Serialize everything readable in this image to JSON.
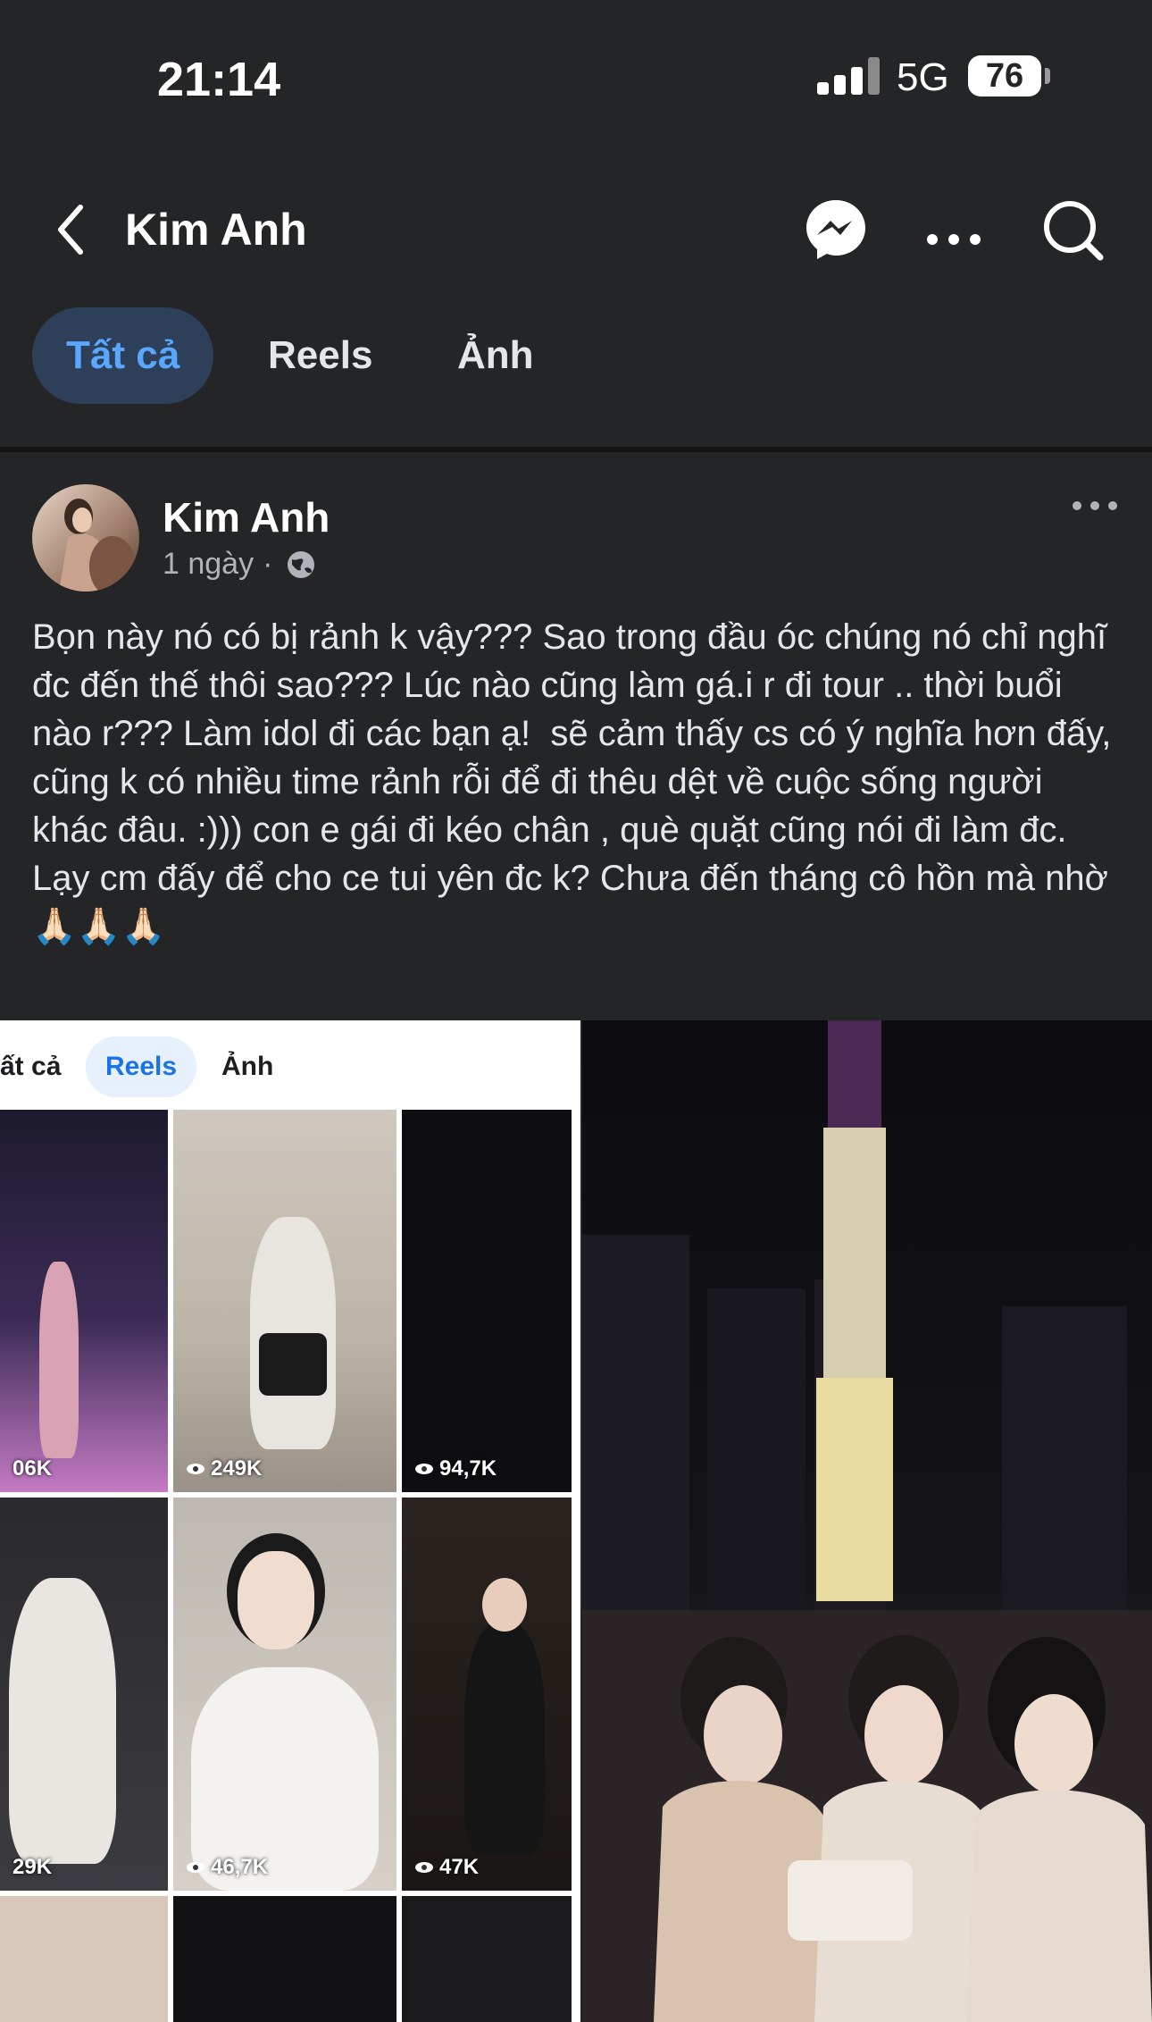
{
  "status_bar": {
    "time": "21:14",
    "network": "5G",
    "battery": "76"
  },
  "header": {
    "title": "Kim Anh"
  },
  "tabs": [
    {
      "label": "Tất cả",
      "active": true
    },
    {
      "label": "Reels",
      "active": false
    },
    {
      "label": "Ảnh",
      "active": false
    }
  ],
  "post": {
    "author": "Kim Anh",
    "time": "1 ngày",
    "separator": "·",
    "text": "Bọn này nó có bị rảnh k vậy??? Sao trong đầu óc chúng nó chỉ nghĩ đc đến thế thôi sao??? Lúc nào cũng làm gá.i r đi tour .. thời buổi nào r??? Làm idol đi các bạn ạ!  sẽ cảm thấy cs có ý nghĩa hơn đấy, cũng k có nhiều time rảnh rỗi để đi thêu dệt về cuộc sống người khác đâu. :))) con e gái đi kéo chân , què quặt cũng nói đi làm đc. Lạy cm đấy để cho ce tui yên đc k? Chưa đến tháng cô hồn mà nhờ 🙏🏻🙏🏻🙏🏻"
  },
  "embedded_screenshot": {
    "tabs": [
      {
        "label": "ất cả",
        "active": false
      },
      {
        "label": "Reels",
        "active": true
      },
      {
        "label": "Ảnh",
        "active": false
      }
    ],
    "reels": [
      {
        "views": "06K",
        "show_eye": false
      },
      {
        "views": "249K",
        "show_eye": true
      },
      {
        "views": "94,7K",
        "show_eye": true
      },
      {
        "views": "29K",
        "show_eye": false
      },
      {
        "views": "46,7K",
        "show_eye": true
      },
      {
        "views": "47K",
        "show_eye": true
      }
    ]
  },
  "colors": {
    "background": "#242526",
    "accent": "#5aa7ff",
    "active_tab_bg": "#2e3f5a"
  },
  "icons": [
    "back-chevron-icon",
    "messenger-icon",
    "more-icon",
    "search-icon",
    "globe-icon",
    "eye-icon"
  ]
}
